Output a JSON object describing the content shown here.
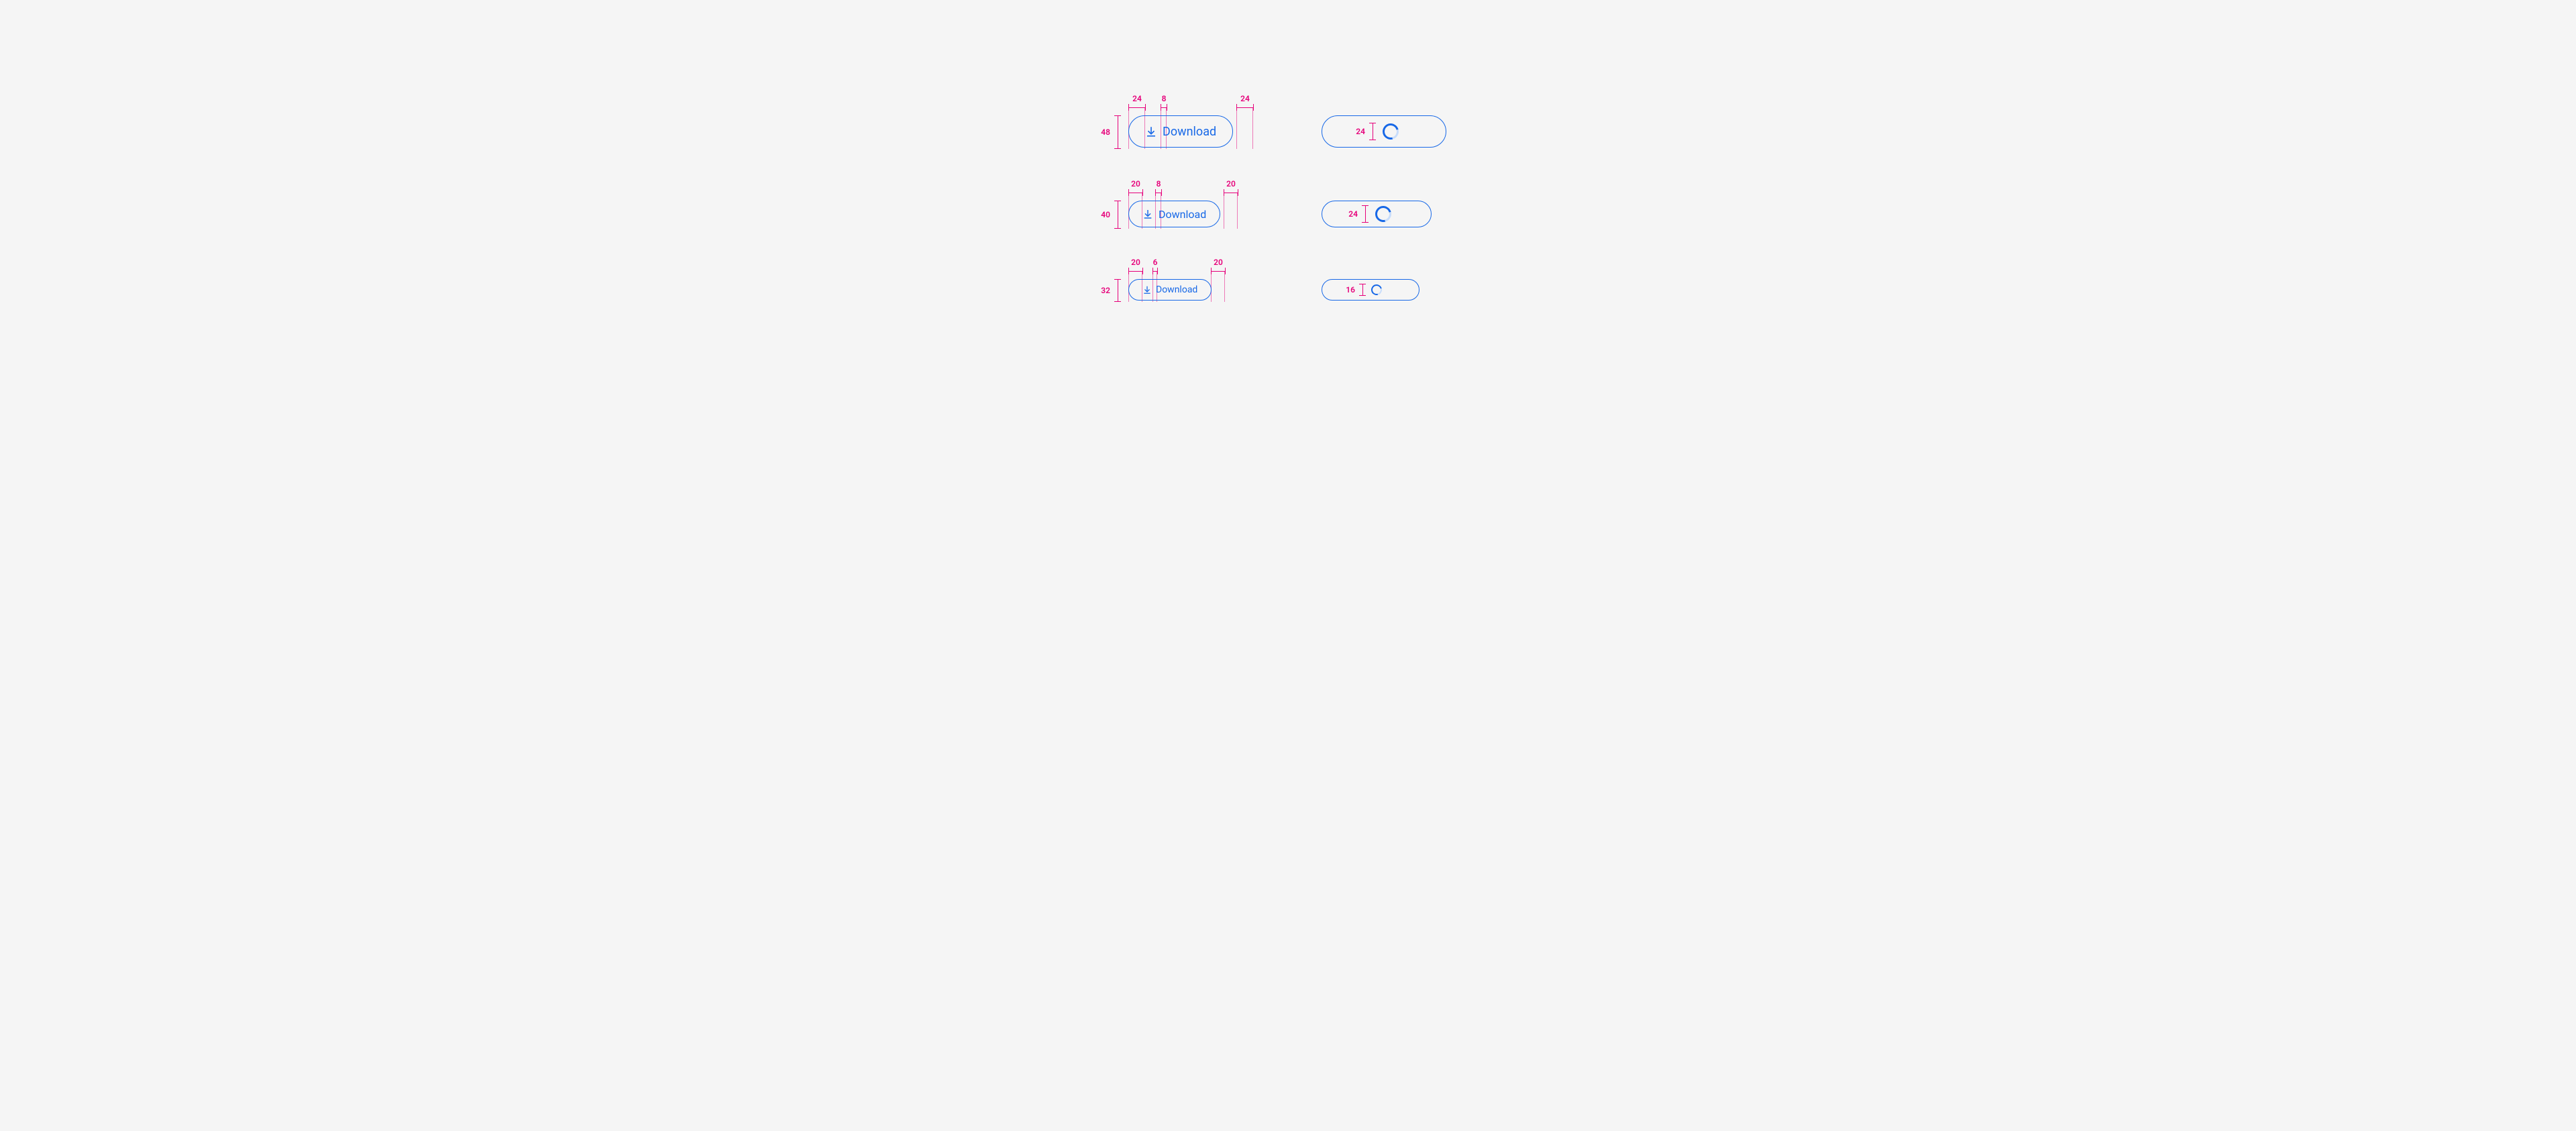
{
  "colors": {
    "accent": "#1768e7",
    "redline": "#e6007a"
  },
  "rows": [
    {
      "height": "48",
      "pad_left": "24",
      "gap": "8",
      "pad_right": "24",
      "label": "Download",
      "spinner": "24"
    },
    {
      "height": "40",
      "pad_left": "20",
      "gap": "8",
      "pad_right": "20",
      "label": "Download",
      "spinner": "24"
    },
    {
      "height": "32",
      "pad_left": "20",
      "gap": "6",
      "pad_right": "20",
      "label": "Download",
      "spinner": "16"
    }
  ]
}
